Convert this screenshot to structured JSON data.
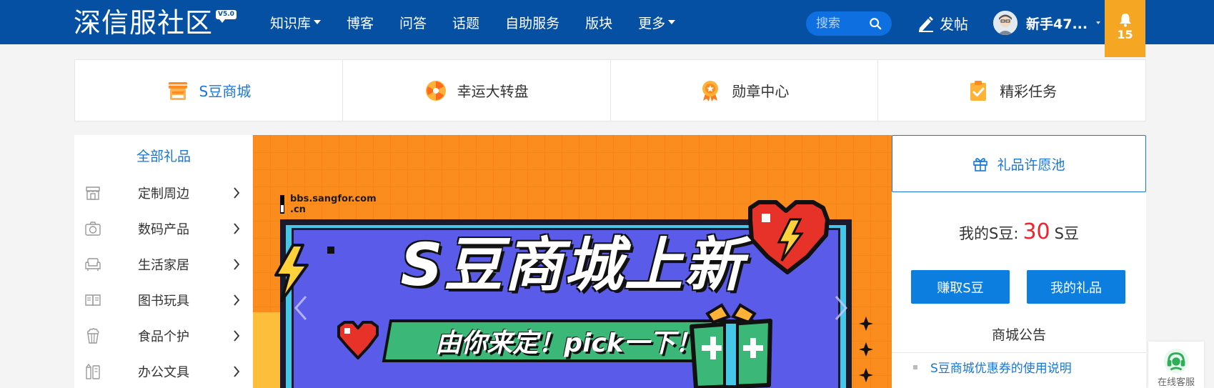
{
  "header": {
    "logo_text": "深信服社区",
    "logo_version": "V5.0",
    "nav": [
      {
        "label": "知识库",
        "dropdown": true
      },
      {
        "label": "博客",
        "dropdown": false
      },
      {
        "label": "问答",
        "dropdown": false
      },
      {
        "label": "话题",
        "dropdown": false
      },
      {
        "label": "自助服务",
        "dropdown": false
      },
      {
        "label": "版块",
        "dropdown": false
      },
      {
        "label": "更多",
        "dropdown": true
      }
    ],
    "search_placeholder": "搜索",
    "post_label": "发帖",
    "username": "新手47...",
    "notification_count": "15"
  },
  "quick_links": [
    {
      "label": "S豆商城",
      "icon": "shop-icon",
      "active": true
    },
    {
      "label": "幸运大转盘",
      "icon": "wheel-icon",
      "active": false
    },
    {
      "label": "勋章中心",
      "icon": "medal-icon",
      "active": false
    },
    {
      "label": "精彩任务",
      "icon": "task-icon",
      "active": false
    }
  ],
  "categories": {
    "title": "全部礼品",
    "items": [
      {
        "label": "定制周边",
        "icon": "store-icon"
      },
      {
        "label": "数码产品",
        "icon": "camera-icon"
      },
      {
        "label": "生活家居",
        "icon": "sofa-icon"
      },
      {
        "label": "图书玩具",
        "icon": "book-icon"
      },
      {
        "label": "食品个护",
        "icon": "popcorn-icon"
      },
      {
        "label": "办公文具",
        "icon": "stationery-icon"
      }
    ]
  },
  "banner": {
    "url_text": "bbs.sangfor.com\n.cn",
    "headline": "S豆商城上新",
    "subline": "由你来定！pick一下！"
  },
  "right_panel": {
    "wish_label": "礼品许愿池",
    "balance_prefix": "我的S豆:",
    "balance_value": "30",
    "balance_unit": "S豆",
    "earn_button": "赚取S豆",
    "my_gifts_button": "我的礼品",
    "notice_title": "商城公告",
    "notices": [
      "S豆商城优惠券的使用说明"
    ]
  },
  "service_label": "在线客服",
  "colors": {
    "brand_blue": "#0650a3",
    "accent_blue": "#1677d9",
    "bell_orange": "#f5a623",
    "banner_orange": "#fb8c1e",
    "balance_red": "#f5222d"
  }
}
